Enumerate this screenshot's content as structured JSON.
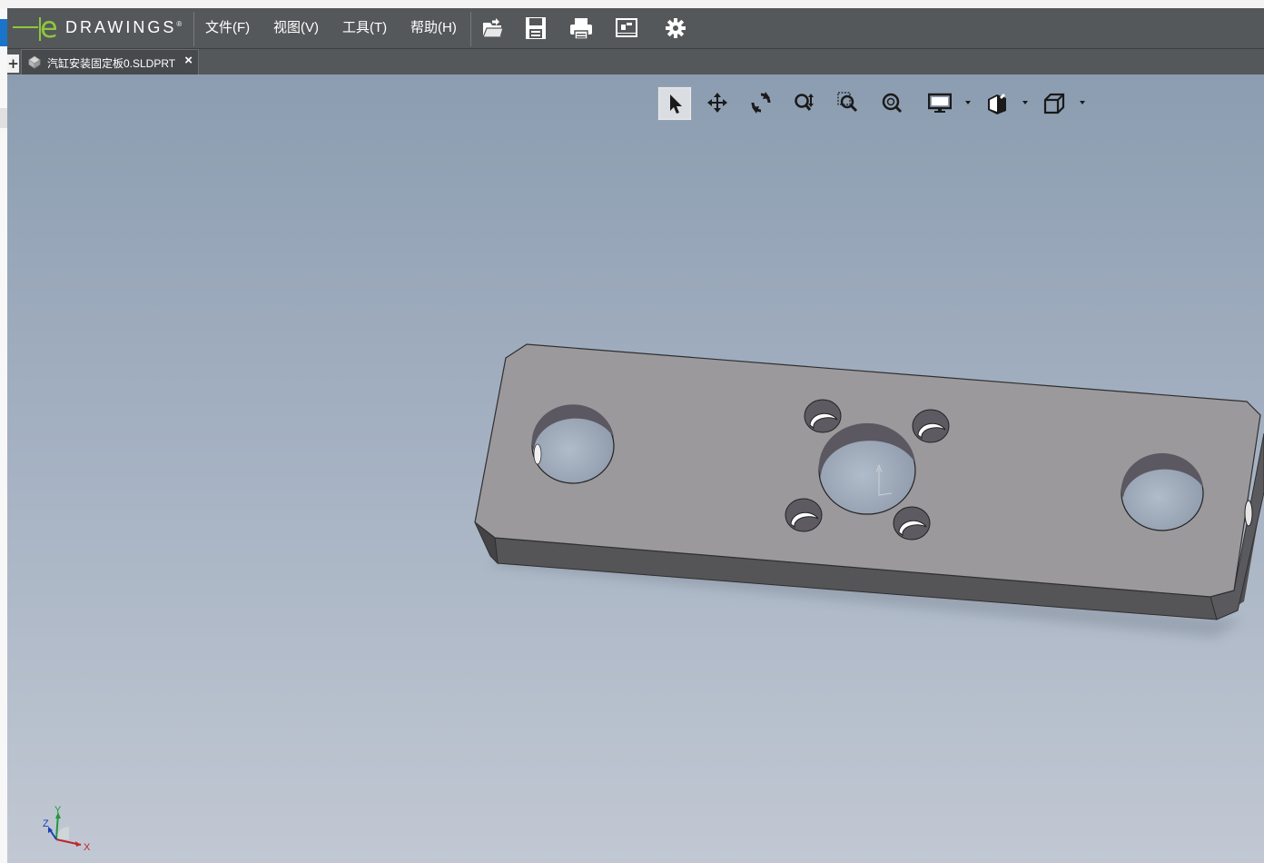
{
  "app": {
    "logo_letter": "e",
    "logo_text": "DRAWINGS",
    "logo_mark": "®",
    "menu": [
      {
        "label": "文件(F)"
      },
      {
        "label": "视图(V)"
      },
      {
        "label": "工具(T)"
      },
      {
        "label": "帮助(H)"
      }
    ],
    "toolbar_icons": [
      "open-icon",
      "save-icon",
      "print-icon",
      "markup-icon",
      "settings-icon"
    ]
  },
  "tabs": {
    "new_tab_label": "+",
    "active": {
      "label": "汽缸安装固定板0.SLDPRT",
      "close_label": "×"
    }
  },
  "viewport": {
    "tools": [
      "select-icon",
      "pan-icon",
      "rotate-icon",
      "zoom-icon",
      "zoom-to-area-icon",
      "zoom-to-fit-icon",
      "display-style-icon",
      "section-icon",
      "standard-views-icon"
    ],
    "triad": {
      "x_label": "X",
      "y_label": "Y",
      "z_label": "Z"
    }
  }
}
